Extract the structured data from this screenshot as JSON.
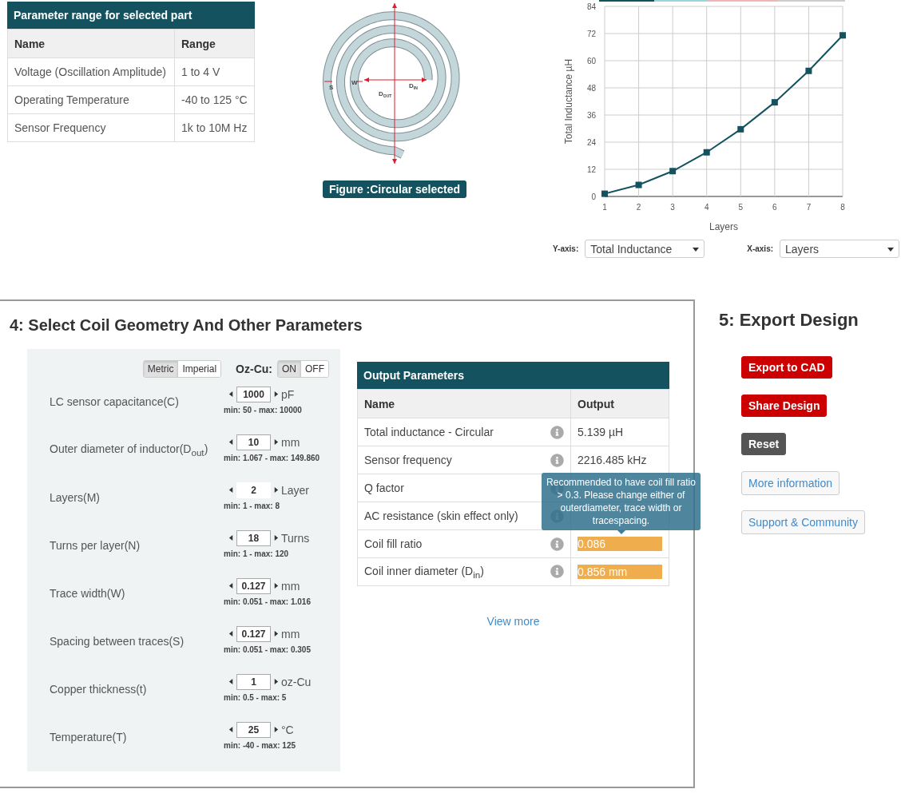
{
  "range_table": {
    "title": "Parameter range for selected part",
    "columns": [
      "Name",
      "Range"
    ],
    "rows": [
      [
        "Voltage (Oscillation Amplitude)",
        "1 to 4 V"
      ],
      [
        "Operating Temperature",
        "-40 to 125 °C"
      ],
      [
        "Sensor Frequency",
        "1k to 10M Hz"
      ]
    ]
  },
  "figure": {
    "caption": "Figure :Circular selected",
    "labels": [
      {
        "kind": "s",
        "main": "S"
      },
      {
        "kind": "w",
        "main": "W"
      },
      {
        "kind": "dout",
        "main": "D",
        "sub": "OUT"
      },
      {
        "kind": "din",
        "main": "D",
        "sub": "IN"
      }
    ]
  },
  "chart": {
    "chart_data": {
      "type": "line",
      "xlabel": "Layers",
      "ylabel": "Total Inductance µH",
      "categories": [
        "1",
        "2",
        "3",
        "4",
        "5",
        "6",
        "7",
        "8"
      ],
      "grid": true,
      "series": [
        {
          "color": "#14525f",
          "marker": "square",
          "values": [
            1.2,
            5.1,
            11.2,
            19.5,
            29.7,
            41.6,
            55.5,
            71.2
          ]
        }
      ],
      "ylim": [
        0,
        84
      ],
      "yticks": [
        0,
        12,
        24,
        36,
        48,
        60,
        72,
        84
      ]
    },
    "axis_selects": [
      {
        "label": "Y-axis:",
        "value": "Total Inductance"
      },
      {
        "label": "X-axis:",
        "value": "Layers"
      }
    ]
  },
  "geometry": {
    "title": "4: Select Coil Geometry And Other Parameters",
    "unit_toggle": [
      {
        "label": "Metric",
        "selected": true
      },
      {
        "label": "Imperial",
        "selected": false
      }
    ],
    "oz_cu": {
      "label": "Oz-Cu:",
      "options": [
        {
          "label": "ON",
          "selected": true
        },
        {
          "label": "OFF",
          "selected": false
        }
      ]
    },
    "params": [
      {
        "label": "LC sensor capacitance(C)",
        "value": "1000",
        "unit": "pF",
        "range": "min: 50 - max: 10000",
        "readonly": false
      },
      {
        "label": "Outer diameter of inductor(D$_{out}$)",
        "value": "10",
        "unit": "mm",
        "range": "min: 1.067 - max: 149.860",
        "readonly": false
      },
      {
        "label": "Layers(M)",
        "value": "2",
        "unit": "Layer",
        "range": "min: 1 - max: 8",
        "readonly": true
      },
      {
        "label": "Turns per layer(N)",
        "value": "18",
        "unit": "Turns",
        "range": "min: 1 - max: 120",
        "readonly": false
      },
      {
        "label": "Trace width(W)",
        "value": "0.127",
        "unit": "mm",
        "range": "min: 0.051 - max: 1.016",
        "readonly": false
      },
      {
        "label": "Spacing between traces(S)",
        "value": "0.127",
        "unit": "mm",
        "range": "min: 0.051 - max: 0.305",
        "readonly": false
      },
      {
        "label": "Copper thickness(t)",
        "value": "1",
        "unit": "oz-Cu",
        "range": "min: 0.5 - max: 5",
        "readonly": false
      },
      {
        "label": "Temperature(T)",
        "value": "25",
        "unit": "°C",
        "range": "min: -40 - max: 125",
        "readonly": false
      }
    ]
  },
  "output": {
    "title": "Output Parameters",
    "columns": [
      "Name",
      "Output"
    ],
    "rows": [
      {
        "name": "Total inductance - Circular",
        "value": "5.139 µH",
        "warning": false
      },
      {
        "name": "Sensor frequency",
        "value": "2216.485 kHz",
        "warning": false
      },
      {
        "name": "Q factor"
      },
      {
        "name": "AC resistance (skin effect only)"
      },
      {
        "name": "Coil fill ratio",
        "value": "0.086",
        "warning": true
      },
      {
        "name": "Coil inner diameter (D$_{in}$)",
        "value": "0.856 mm",
        "warning": true
      }
    ],
    "tooltip": "Recommended to have coil fill ratio > 0.3. Please change either of outerdiameter, trace width or tracespacing.",
    "view_more": "View more"
  },
  "export": {
    "title": "5: Export Design",
    "buttons": [
      {
        "label": "Export to CAD",
        "kind": "primary"
      },
      {
        "label": "Share Design",
        "kind": "primary"
      },
      {
        "label": "Reset",
        "kind": "dark"
      },
      {
        "label": "More information",
        "kind": "outline"
      },
      {
        "label": "Support & Community",
        "kind": "outline"
      }
    ]
  }
}
